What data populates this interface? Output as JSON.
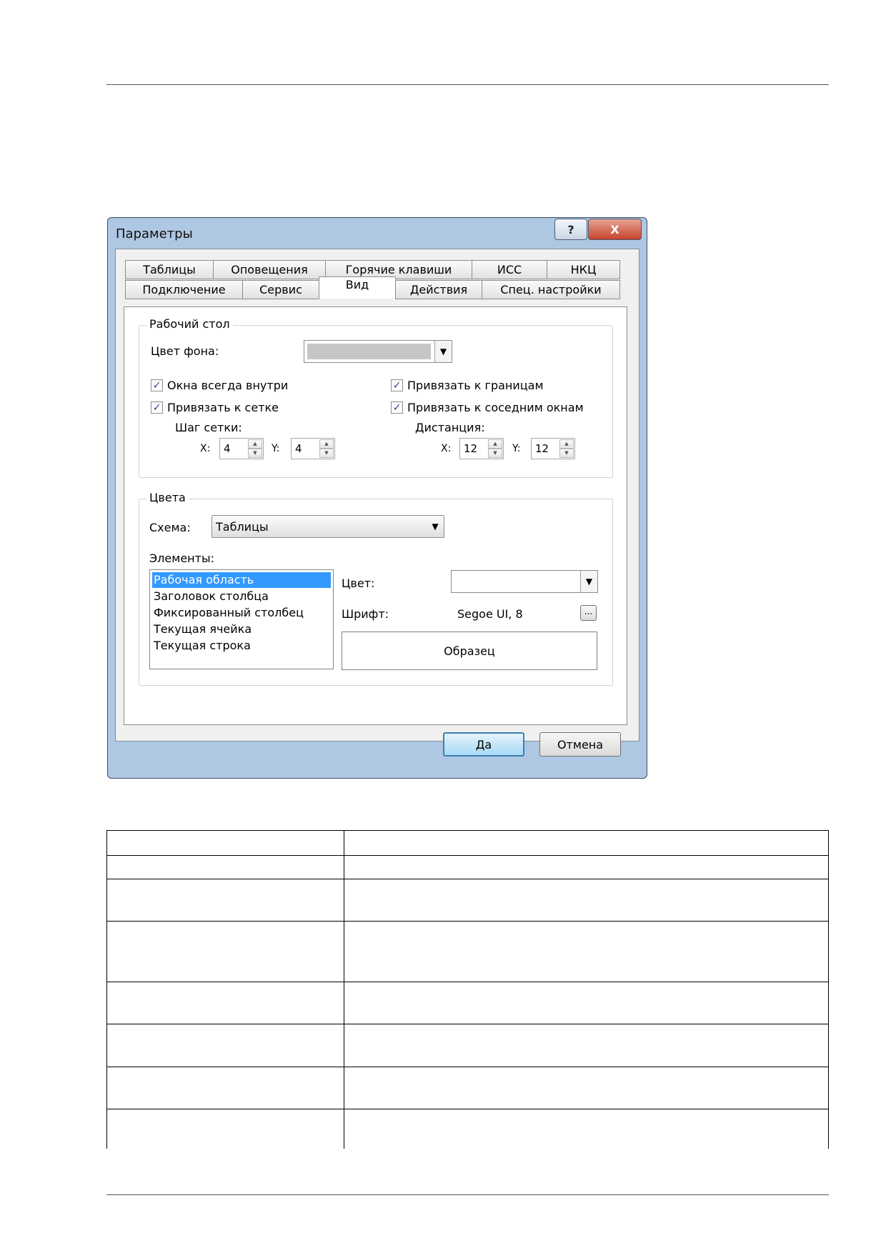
{
  "dialog": {
    "title": "Параметры",
    "help_glyph": "?",
    "close_glyph": "X"
  },
  "tabs_row1": [
    "Таблицы",
    "Оповещения",
    "Горячие клавиши",
    "ИСС",
    "НКЦ"
  ],
  "tabs_row2": [
    "Подключение",
    "Сервис",
    "Вид",
    "Действия",
    "Спец. настройки"
  ],
  "desktop": {
    "legend": "Рабочий стол",
    "bg_color_label": "Цвет фона:",
    "bg_color_value": "#c6c6c6",
    "checkboxes": [
      {
        "label": "Окна всегда внутри",
        "checked": true
      },
      {
        "label": "Привязать к сетке",
        "checked": true
      },
      {
        "label": "Привязать к границам",
        "checked": true
      },
      {
        "label": "Привязать к соседним окнам",
        "checked": true
      }
    ],
    "grid_step_label": "Шаг сетки:",
    "distance_label": "Дистанция:",
    "x_label": "X:",
    "y_label": "Y:",
    "grid_x": "4",
    "grid_y": "4",
    "dist_x": "12",
    "dist_y": "12"
  },
  "colors": {
    "legend": "Цвета",
    "scheme_label": "Схема:",
    "scheme_value": "Таблицы",
    "elements_label": "Элементы:",
    "elements": [
      "Рабочая область",
      "Заголовок столбца",
      "Фиксированный столбец",
      "Текущая ячейка",
      "Текущая строка"
    ],
    "selected_index": 0,
    "color_label": "Цвет:",
    "font_label": "Шрифт:",
    "font_value": "Segoe UI, 8",
    "browse_label": "...",
    "sample_label": "Образец"
  },
  "buttons": {
    "ok": "Да",
    "cancel": "Отмена"
  },
  "icons": {
    "check": "✓",
    "arrow_down": "▼",
    "arrow_up": "▲"
  }
}
